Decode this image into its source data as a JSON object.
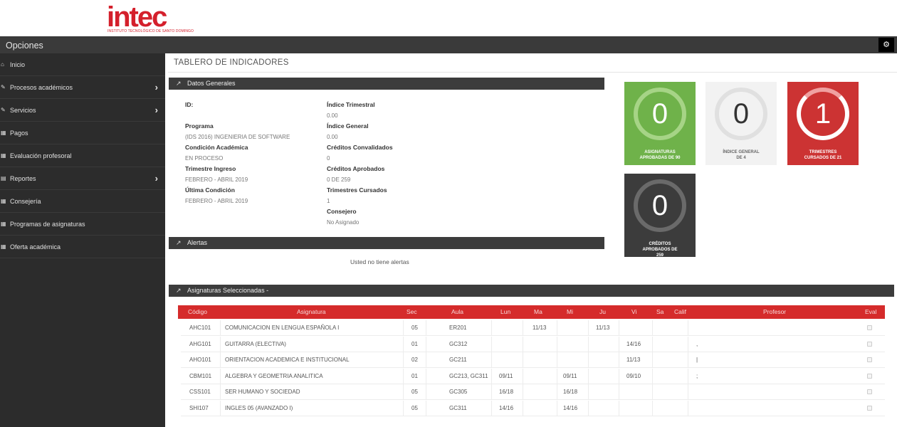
{
  "logo": {
    "word": "intec",
    "subtitle": "INSTITUTO TECNOLÓGICO DE SANTO DOMINGO"
  },
  "sidebar": {
    "title": "Opciones",
    "items": [
      {
        "label": "Inicio",
        "icon": "home-icon",
        "glyph": "⌂",
        "submenu": false
      },
      {
        "label": "Procesos académicos",
        "icon": "edit-icon",
        "glyph": "✎",
        "submenu": true
      },
      {
        "label": "Servicios",
        "icon": "edit-icon",
        "glyph": "✎",
        "submenu": true
      },
      {
        "label": "Pagos",
        "icon": "calendar-icon",
        "glyph": "▦",
        "submenu": false
      },
      {
        "label": "Evaluación profesoral",
        "icon": "calendar-icon",
        "glyph": "▦",
        "submenu": false
      },
      {
        "label": "Reportes",
        "icon": "chart-icon",
        "glyph": "▤",
        "submenu": true
      },
      {
        "label": "Consejería",
        "icon": "calendar-icon",
        "glyph": "▦",
        "submenu": false
      },
      {
        "label": "Programas de asignaturas",
        "icon": "calendar-icon",
        "glyph": "▦",
        "submenu": false
      },
      {
        "label": "Oferta académica",
        "icon": "calendar-icon",
        "glyph": "▦",
        "submenu": false
      }
    ],
    "chevron": "›"
  },
  "page_title": "TABLERO DE INDICADORES",
  "panels": {
    "datos": "Datos Generales",
    "alertas": "Alertas",
    "asignaturas": "Asignaturas Seleccionadas -"
  },
  "datos_generales": {
    "left": [
      {
        "label": "ID:",
        "value": ""
      },
      {
        "label": "Programa",
        "value": "(IDS 2016) INGENIERIA DE SOFTWARE"
      },
      {
        "label": "Condición Académica",
        "value": "EN PROCESO"
      },
      {
        "label": "Trimestre Ingreso",
        "value": "FEBRERO - ABRIL 2019"
      },
      {
        "label": "Última Condición",
        "value": "FEBRERO - ABRIL 2019"
      }
    ],
    "right": [
      {
        "label": "Índice Trimestral",
        "value": "0.00"
      },
      {
        "label": "Índice General",
        "value": "0.00"
      },
      {
        "label": "Créditos Convalidados",
        "value": "0"
      },
      {
        "label": "Créditos Aprobados",
        "value": "0 DE 259"
      },
      {
        "label": "Trimestres Cursados",
        "value": "1"
      },
      {
        "label": "Consejero",
        "value": "No Asignado"
      }
    ]
  },
  "alerts_text": "Usted no tiene alertas",
  "tiles": [
    {
      "value": "0",
      "caption1": "ASIGNATURAS",
      "caption2": "APROBADAS DE 90",
      "bg": "#6fb24a",
      "ring": "#a6d486",
      "text": "#ffffff"
    },
    {
      "value": "0",
      "caption1": "ÍNDICE GENERAL",
      "caption2": "DE 4",
      "bg": "#f2f2f2",
      "ring": "#e0e0e0",
      "text": "#333333"
    },
    {
      "value": "1",
      "caption1": "TRIMESTRES",
      "caption2": "CURSADOS DE 21",
      "bg": "#cc3333",
      "ring": "#ffffff",
      "text": "#ffffff"
    },
    {
      "value": "0",
      "caption1": "CRÉDITOS",
      "caption2": "APROBADOS DE",
      "caption3": "259",
      "bg": "#3c3c3c",
      "ring": "#6a6a6a",
      "text": "#ffffff"
    }
  ],
  "table": {
    "headers": [
      "Código",
      "Asignatura",
      "Sec",
      "Aula",
      "Lun",
      "Ma",
      "Mi",
      "Ju",
      "Vi",
      "Sa",
      "Calif",
      "Profesor",
      "Eval"
    ],
    "rows": [
      {
        "codigo": "AHC101",
        "asignatura": "COMUNICACION EN LENGUA ESPAÑOLA I",
        "sec": "05",
        "aula": "ER201",
        "lun": "",
        "ma": "11/13",
        "mi": "",
        "ju": "11/13",
        "vi": "",
        "sa": "",
        "calif": "",
        "profesor": ""
      },
      {
        "codigo": "AHG101",
        "asignatura": "GUITARRA (ELECTIVA)",
        "sec": "01",
        "aula": "GC312",
        "lun": "",
        "ma": "",
        "mi": "",
        "ju": "",
        "vi": "14/16",
        "sa": "",
        "calif": "",
        "profesor": ","
      },
      {
        "codigo": "AHO101",
        "asignatura": "ORIENTACION ACADEMICA E INSTITUCIONAL",
        "sec": "02",
        "aula": "GC211",
        "lun": "",
        "ma": "",
        "mi": "",
        "ju": "",
        "vi": "11/13",
        "sa": "",
        "calif": "",
        "profesor": "|"
      },
      {
        "codigo": "CBM101",
        "asignatura": "ALGEBRA Y GEOMETRIA ANALITICA",
        "sec": "01",
        "aula": "GC213, GC311",
        "lun": "09/11",
        "ma": "",
        "mi": "09/11",
        "ju": "",
        "vi": "09/10",
        "sa": "",
        "calif": "",
        "profesor": ";"
      },
      {
        "codigo": "CSS101",
        "asignatura": "SER HUMANO Y SOCIEDAD",
        "sec": "05",
        "aula": "GC305",
        "lun": "16/18",
        "ma": "",
        "mi": "16/18",
        "ju": "",
        "vi": "",
        "sa": "",
        "calif": "",
        "profesor": ""
      },
      {
        "codigo": "SHI107",
        "asignatura": "INGLES 05 (AVANZADO I)",
        "sec": "05",
        "aula": "GC311",
        "lun": "14/16",
        "ma": "",
        "mi": "14/16",
        "ju": "",
        "vi": "",
        "sa": "",
        "calif": "",
        "profesor": ""
      }
    ]
  }
}
